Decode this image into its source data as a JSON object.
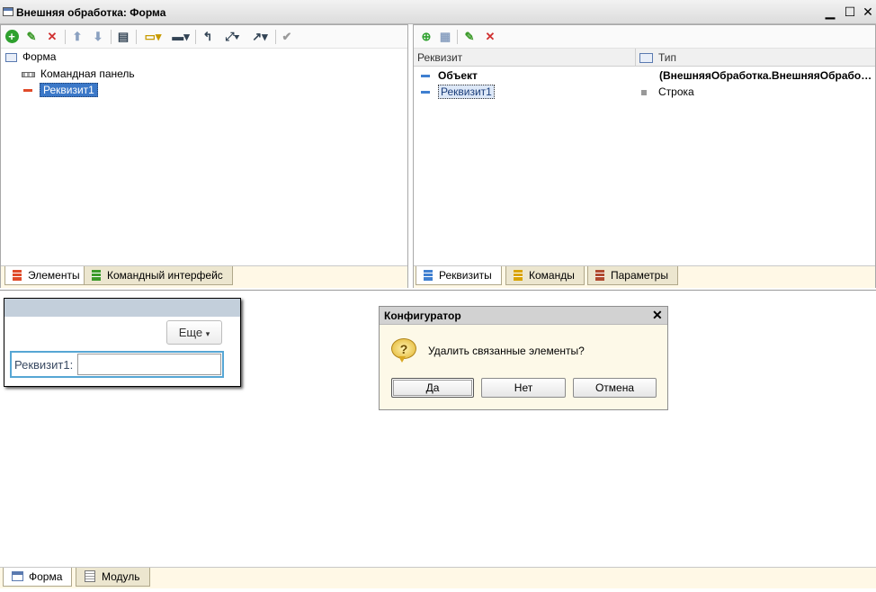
{
  "window": {
    "title": "Внешняя обработка: Форма",
    "min": "▁",
    "max": "☐",
    "close": "✕"
  },
  "elements_pane": {
    "tree": {
      "root": "Форма",
      "command_bar": "Командная панель",
      "attr": "Реквизит1"
    },
    "tabs": [
      "Элементы",
      "Командный интерфейс"
    ]
  },
  "attributes_pane": {
    "columns": {
      "attribute": "Реквизит",
      "type": "Тип"
    },
    "rows": [
      {
        "name": "Объект",
        "type": "(ВнешняяОбработка.ВнешняяОбрабо…"
      },
      {
        "name": "Реквизит1",
        "type": "Строка"
      }
    ],
    "tabs": [
      "Реквизиты",
      "Команды",
      "Параметры"
    ]
  },
  "preview": {
    "more_button": "Еще",
    "field_label": "Реквизит1:",
    "field_value": ""
  },
  "dialog": {
    "title": "Конфигуратор",
    "message": "Удалить связанные элементы?",
    "buttons": {
      "yes": "Да",
      "no": "Нет",
      "cancel": "Отмена"
    },
    "close": "✕"
  },
  "bottom_tabs": [
    "Форма",
    "Модуль"
  ],
  "colors": {
    "accent": "#3b78c8",
    "add": "#2fa12f",
    "delete": "#d03030",
    "edit": "#3c9a2a",
    "attr_red": "#e04b2a",
    "attr_blue": "#3f7fd0"
  }
}
